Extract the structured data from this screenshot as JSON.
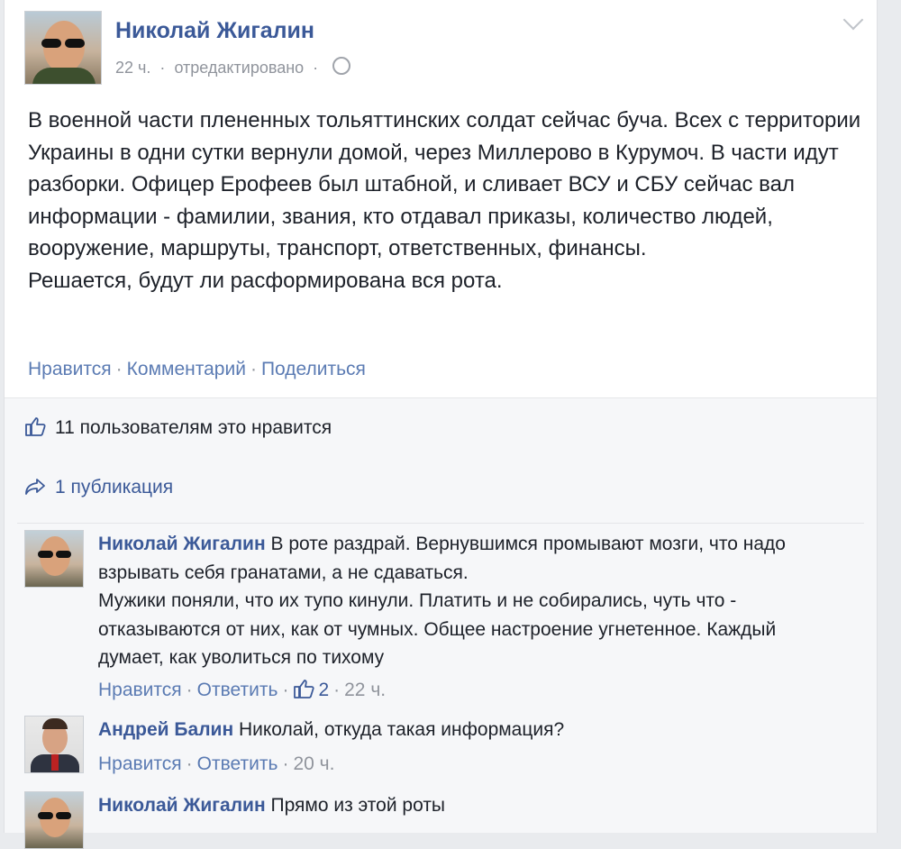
{
  "post": {
    "author": "Николай Жигалин",
    "time": "22 ч.",
    "edited": "отредактировано",
    "text_lines": [
      "В военной части плененных тольяттинских солдат сейчас буча. Всех с территории Украины в одни сутки вернули домой, через Миллерово в Курумоч. В части идут разборки. Офицер Ерофеев был штабной, и сливает ВСУ и СБУ сейчас вал информации - фамилии, звания, кто отдавал приказы, количество людей, вооружение, маршруты, транспорт, ответственных, финансы.",
      "Решается, будут ли расформирована вся рота."
    ],
    "actions": {
      "like": "Нравится",
      "comment": "Комментарий",
      "share": "Поделиться"
    }
  },
  "feedback": {
    "likes": "11 пользователям это нравится",
    "shares": "1 публикация"
  },
  "comments": [
    {
      "author": "Николай Жигалин",
      "text": "В роте раздрай. Вернувшимся промывают мозги, что надо взрывать себя гранатами, а не сдаваться.",
      "text2": "Мужики поняли, что их тупо кинули. Платить и не собирались, чуть что - отказываются от них, как от чумных. Общее настроение угнетенное. Каждый думает, как уволиться по тихому",
      "like": "Нравится",
      "reply": "Ответить",
      "like_count": "2",
      "time": "22 ч."
    },
    {
      "author": "Андрей Балин",
      "text": "Николай, откуда такая информация?",
      "like": "Нравится",
      "reply": "Ответить",
      "time": "20 ч."
    },
    {
      "author": "Николай Жигалин",
      "text": "Прямо из этой роты"
    }
  ],
  "colors": {
    "link": "#3b5998",
    "action": "#5b7bb3",
    "muted": "#90949c",
    "text": "#1d2129"
  }
}
